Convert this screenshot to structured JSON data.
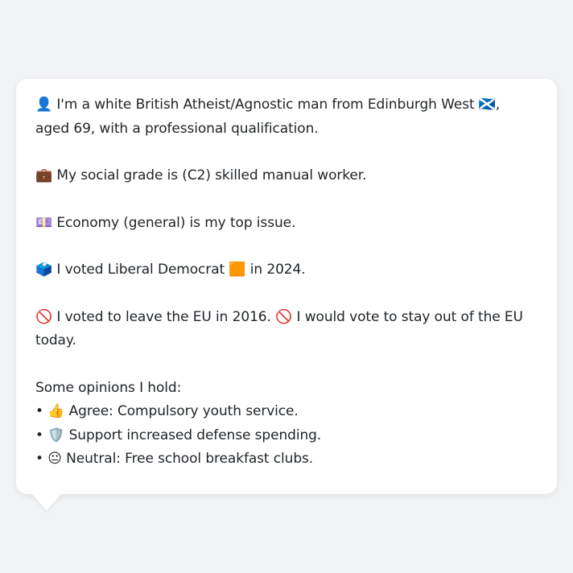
{
  "persona": {
    "intro": "👤 I'm a white British Atheist/Agnostic man from Edinburgh West 🏴󠁧󠁢󠁳󠁣󠁴󠁿, aged 69, with a professional qualification.",
    "social_grade": "💼 My social grade is (C2) skilled manual worker.",
    "top_issue": "💷 Economy (general) is my top issue.",
    "vote_2024": "🗳️ I voted Liberal Democrat 🟧 in 2024.",
    "eu": "🚫 I voted to leave the EU in 2016. 🚫 I would vote to stay out of the EU today.",
    "opinions_heading": "Some opinions I hold:",
    "opinions": [
      "• 👍 Agree: Compulsory youth service.",
      "• 🛡️ Support increased defense spending.",
      "• 😐 Neutral: Free school breakfast clubs."
    ]
  }
}
